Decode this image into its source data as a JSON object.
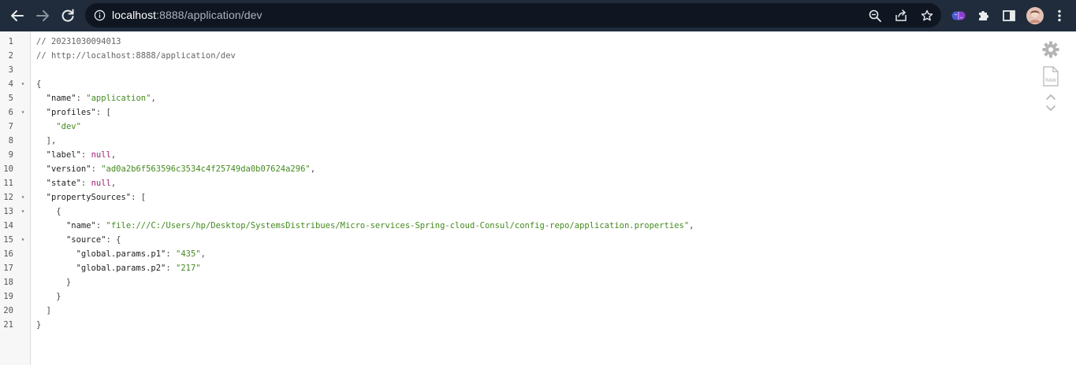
{
  "browser": {
    "url_host": "localhost",
    "url_rest": ":8888/application/dev",
    "icons": {
      "back": "arrow-left-icon",
      "forward": "arrow-right-icon",
      "reload": "reload-icon",
      "site_info": "info-icon",
      "zoom": "zoom-icon",
      "share": "share-icon",
      "bookmark": "star-icon",
      "extension_brain": "brain-extension-icon",
      "extensions": "puzzle-icon",
      "side_panel": "side-panel-icon",
      "profile": "avatar",
      "menu": "kebab-menu-icon"
    }
  },
  "json_viewer": {
    "lines": [
      {
        "n": "1",
        "fold": "",
        "tokens": [
          {
            "t": "c",
            "v": "// 20231030094013"
          }
        ]
      },
      {
        "n": "2",
        "fold": "",
        "tokens": [
          {
            "t": "c",
            "v": "// http://localhost:8888/application/dev"
          }
        ]
      },
      {
        "n": "3",
        "fold": "",
        "tokens": []
      },
      {
        "n": "4",
        "fold": "▾",
        "tokens": [
          {
            "t": "p",
            "v": "{"
          }
        ]
      },
      {
        "n": "5",
        "fold": "",
        "tokens": [
          {
            "t": "p",
            "v": "  "
          },
          {
            "t": "k",
            "v": "\"name\""
          },
          {
            "t": "p",
            "v": ": "
          },
          {
            "t": "s",
            "v": "\"application\""
          },
          {
            "t": "p",
            "v": ","
          }
        ]
      },
      {
        "n": "6",
        "fold": "▾",
        "tokens": [
          {
            "t": "p",
            "v": "  "
          },
          {
            "t": "k",
            "v": "\"profiles\""
          },
          {
            "t": "p",
            "v": ": ["
          }
        ]
      },
      {
        "n": "7",
        "fold": "",
        "tokens": [
          {
            "t": "p",
            "v": "    "
          },
          {
            "t": "s",
            "v": "\"dev\""
          }
        ]
      },
      {
        "n": "8",
        "fold": "",
        "tokens": [
          {
            "t": "p",
            "v": "  ],"
          }
        ]
      },
      {
        "n": "9",
        "fold": "",
        "tokens": [
          {
            "t": "p",
            "v": "  "
          },
          {
            "t": "k",
            "v": "\"label\""
          },
          {
            "t": "p",
            "v": ": "
          },
          {
            "t": "n",
            "v": "null"
          },
          {
            "t": "p",
            "v": ","
          }
        ]
      },
      {
        "n": "10",
        "fold": "",
        "tokens": [
          {
            "t": "p",
            "v": "  "
          },
          {
            "t": "k",
            "v": "\"version\""
          },
          {
            "t": "p",
            "v": ": "
          },
          {
            "t": "s",
            "v": "\"ad0a2b6f563596c3534c4f25749da0b07624a296\""
          },
          {
            "t": "p",
            "v": ","
          }
        ]
      },
      {
        "n": "11",
        "fold": "",
        "tokens": [
          {
            "t": "p",
            "v": "  "
          },
          {
            "t": "k",
            "v": "\"state\""
          },
          {
            "t": "p",
            "v": ": "
          },
          {
            "t": "n",
            "v": "null"
          },
          {
            "t": "p",
            "v": ","
          }
        ]
      },
      {
        "n": "12",
        "fold": "▾",
        "tokens": [
          {
            "t": "p",
            "v": "  "
          },
          {
            "t": "k",
            "v": "\"propertySources\""
          },
          {
            "t": "p",
            "v": ": ["
          }
        ]
      },
      {
        "n": "13",
        "fold": "▾",
        "tokens": [
          {
            "t": "p",
            "v": "    {"
          }
        ]
      },
      {
        "n": "14",
        "fold": "",
        "tokens": [
          {
            "t": "p",
            "v": "      "
          },
          {
            "t": "k",
            "v": "\"name\""
          },
          {
            "t": "p",
            "v": ": "
          },
          {
            "t": "s",
            "v": "\"file:///C:/Users/hp/Desktop/SystemsDistribues/Micro-services-Spring-cloud-Consul/config-repo/application.properties\""
          },
          {
            "t": "p",
            "v": ","
          }
        ]
      },
      {
        "n": "15",
        "fold": "▾",
        "tokens": [
          {
            "t": "p",
            "v": "      "
          },
          {
            "t": "k",
            "v": "\"source\""
          },
          {
            "t": "p",
            "v": ": {"
          }
        ]
      },
      {
        "n": "16",
        "fold": "",
        "tokens": [
          {
            "t": "p",
            "v": "        "
          },
          {
            "t": "k",
            "v": "\"global.params.p1\""
          },
          {
            "t": "p",
            "v": ": "
          },
          {
            "t": "s",
            "v": "\"435\""
          },
          {
            "t": "p",
            "v": ","
          }
        ]
      },
      {
        "n": "17",
        "fold": "",
        "tokens": [
          {
            "t": "p",
            "v": "        "
          },
          {
            "t": "k",
            "v": "\"global.params.p2\""
          },
          {
            "t": "p",
            "v": ": "
          },
          {
            "t": "s",
            "v": "\"217\""
          }
        ]
      },
      {
        "n": "18",
        "fold": "",
        "tokens": [
          {
            "t": "p",
            "v": "      }"
          }
        ]
      },
      {
        "n": "19",
        "fold": "",
        "tokens": [
          {
            "t": "p",
            "v": "    }"
          }
        ]
      },
      {
        "n": "20",
        "fold": "",
        "tokens": [
          {
            "t": "p",
            "v": "  ]"
          }
        ]
      },
      {
        "n": "21",
        "fold": "",
        "tokens": [
          {
            "t": "p",
            "v": "}"
          }
        ]
      }
    ],
    "side_tools": {
      "settings": "gear-icon",
      "raw": "raw-file-icon",
      "raw_label": "RAW",
      "toggle": "expand-collapse-icon"
    }
  },
  "colors": {
    "toolbar_bg": "#202c3c",
    "omnibox_bg": "#0f1622",
    "string": "#448a1f",
    "null": "#9a1f6e",
    "comment": "#666666"
  }
}
